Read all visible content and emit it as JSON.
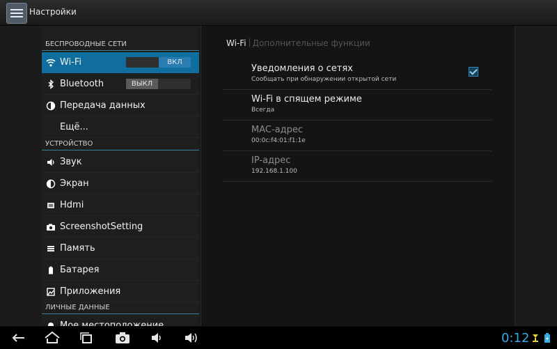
{
  "app": {
    "title": "Настройки"
  },
  "sidebar": {
    "sections": {
      "wireless": "БЕСПРОВОДНЫЕ СЕТИ",
      "device": "УСТРОЙСТВО",
      "personal": "ЛИЧНЫЕ ДАННЫЕ"
    },
    "items": [
      {
        "label": "Wi-Fi",
        "icon": "wifi-icon",
        "toggle": "ВКЛ",
        "selected": true
      },
      {
        "label": "Bluetooth",
        "icon": "bluetooth-icon",
        "toggle": "ВЫКЛ"
      },
      {
        "label": "Передача данных",
        "icon": "data-usage-icon"
      },
      {
        "label": "Ещё..."
      },
      {
        "label": "Звук",
        "icon": "volume-icon"
      },
      {
        "label": "Экран",
        "icon": "display-icon"
      },
      {
        "label": "Hdmi",
        "icon": "hdmi-icon"
      },
      {
        "label": "ScreenshotSetting",
        "icon": "camera-icon"
      },
      {
        "label": "Память",
        "icon": "storage-icon"
      },
      {
        "label": "Батарея",
        "icon": "battery-icon"
      },
      {
        "label": "Приложения",
        "icon": "apps-icon"
      },
      {
        "label": "Мое местоположение",
        "icon": "location-icon"
      }
    ]
  },
  "main": {
    "tabs": [
      "Wi-Fi",
      "Дополнительные функции"
    ],
    "preferences": [
      {
        "title": "Уведомления о сетях",
        "summary": "Сообщать при обнаружении открытой сети",
        "checked": true
      },
      {
        "title": "Wi-Fi в спящем режиме",
        "summary": "Всегда"
      },
      {
        "title": "MAC-адрес",
        "summary": "00:0c:f4:01:f1:1e"
      },
      {
        "title": "IP-адрес",
        "summary": "192.168.1.100"
      }
    ]
  },
  "status": {
    "time": "0:12"
  },
  "colors": {
    "accent": "#0f6e9d",
    "clock": "#36a9e1"
  }
}
